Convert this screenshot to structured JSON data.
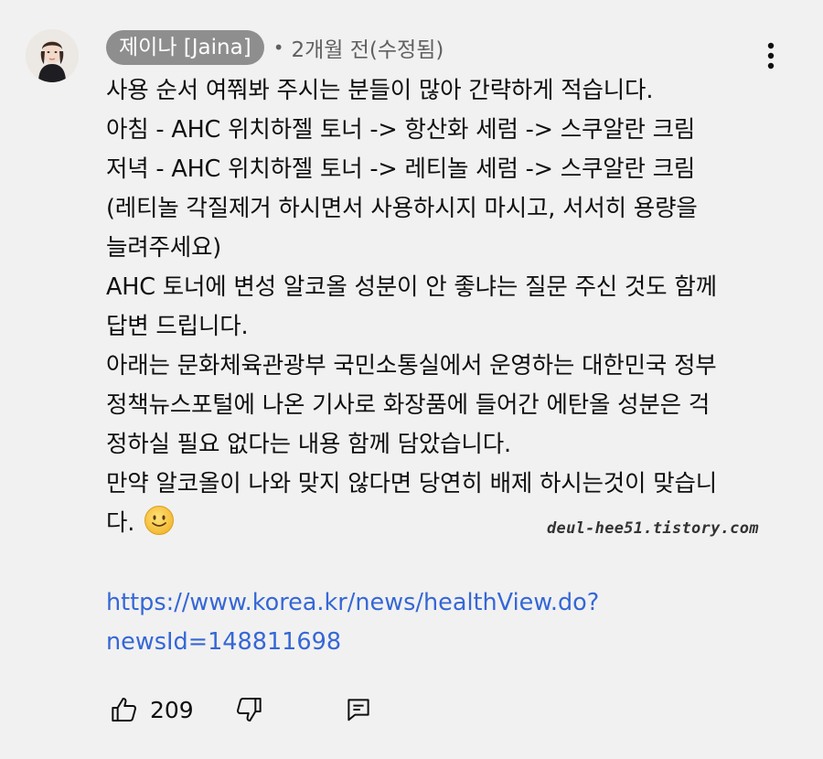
{
  "comment": {
    "author": "제이나 [Jaina]",
    "separator": "•",
    "time": "2개월 전(수정됨)",
    "body_lines": [
      "사용 순서 여쭤봐 주시는 분들이 많아 간략하게 적습니다.",
      "아침 - AHC 위치하젤 토너 -> 항산화 세럼 -> 스쿠알란 크림",
      "저녁 - AHC 위치하젤 토너 -> 레티놀 세럼 -> 스쿠알란 크림",
      "(레티놀 각질제거 하시면서 사용하시지 마시고, 서서히 용량을",
      "늘려주세요)",
      "AHC 토너에 변성 알코올 성분이 안 좋냐는 질문 주신 것도 함께",
      "답변 드립니다.",
      "아래는 문화체육관광부 국민소통실에서 운영하는 대한민국 정부",
      "정책뉴스포털에 나온 기사로 화장품에 들어간 에탄올 성분은 걱",
      "정하실 필요 없다는 내용 함께 담았습니다.",
      "만약 알코올이 나와 맞지 않다면 당연히 배제 하시는것이 맞습니",
      "다."
    ],
    "link_lines": [
      "https://www.korea.kr/news/healthView.do?",
      "newsId=148811698"
    ],
    "like_count": "209"
  },
  "watermark": "deul-hee51.tistory.com",
  "icons": {
    "more": "more-vert-icon",
    "like": "thumb-up-icon",
    "dislike": "thumb-down-icon",
    "reply": "comment-reply-icon",
    "emoji": "smiling-face-emoji"
  },
  "colors": {
    "background": "#f1f1f1",
    "author_chip": "#8e8e8e",
    "meta": "#606060",
    "link": "#3567d6",
    "text": "#0f0f0f"
  }
}
